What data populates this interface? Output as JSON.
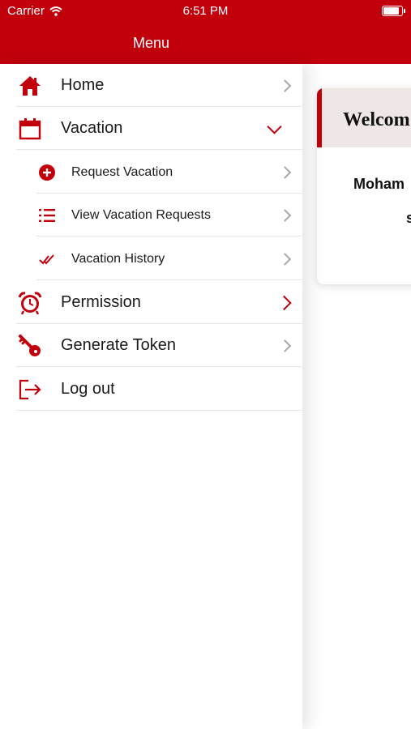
{
  "status_bar": {
    "carrier": "Carrier",
    "time": "6:51 PM"
  },
  "header": {
    "title": "Menu"
  },
  "menu": {
    "home": {
      "label": "Home",
      "icon": "home-icon"
    },
    "vacation": {
      "label": "Vacation",
      "icon": "calendar-icon",
      "expanded": true
    },
    "request_vacation": {
      "label": "Request Vacation",
      "icon": "plus-circle-icon"
    },
    "view_vacation_requests": {
      "label": "View Vacation Requests",
      "icon": "list-icon"
    },
    "vacation_history": {
      "label": "Vacation History",
      "icon": "double-check-icon"
    },
    "permission": {
      "label": "Permission",
      "icon": "alarm-clock-icon"
    },
    "generate_token": {
      "label": "Generate Token",
      "icon": "key-icon"
    },
    "logout": {
      "label": "Log out",
      "icon": "logout-icon"
    }
  },
  "welcome_card": {
    "title": "Welcom",
    "name": "Moham",
    "line2": "s"
  },
  "colors": {
    "accent": "#c1000c",
    "card_header_bg": "#efe6e6",
    "separator": "#e6e6e6"
  }
}
